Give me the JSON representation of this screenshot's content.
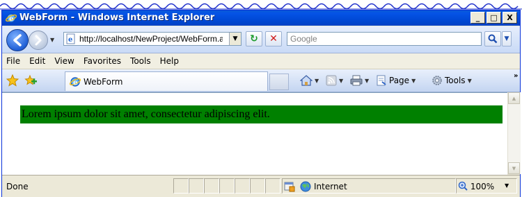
{
  "window": {
    "title": "WebForm - Windows Internet Explorer"
  },
  "title_buttons": {
    "minimize": "_",
    "maximize": "□",
    "close": "X"
  },
  "address": {
    "url": "http://localhost/NewProject/WebForm.aspx"
  },
  "search": {
    "placeholder": "Google"
  },
  "menu": [
    "File",
    "Edit",
    "View",
    "Favorites",
    "Tools",
    "Help"
  ],
  "tab": {
    "label": "WebForm"
  },
  "commands": {
    "page": "Page",
    "tools": "Tools"
  },
  "content": {
    "banner_text": "Lorem ipsum dolor sit amet, consectetur adipiscing elit.",
    "banner_color": "#008000"
  },
  "status": {
    "text": "Done",
    "zone": "Internet",
    "zoom": "100%"
  },
  "colors": {
    "title_bar": "#0049d6",
    "chrome": "#ece9d8",
    "toolbar": "#c9daf6"
  }
}
